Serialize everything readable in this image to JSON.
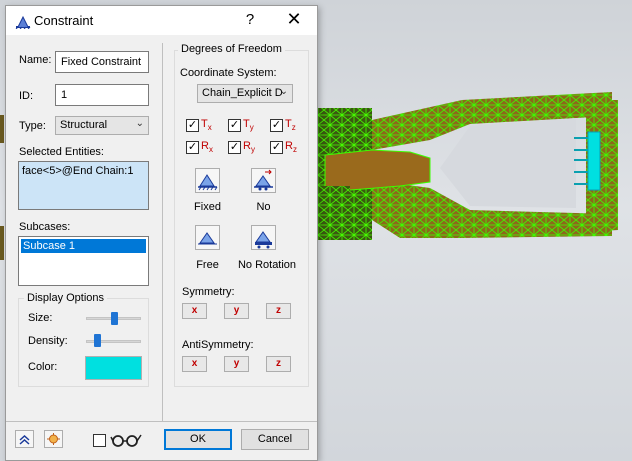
{
  "dialog": {
    "title": "Constraint",
    "help_glyph": "?",
    "close_glyph": "✕"
  },
  "fields": {
    "name_label": "Name:",
    "name_value": "Fixed Constraint",
    "id_label": "ID:",
    "id_value": "1",
    "type_label": "Type:",
    "type_value": "Structural",
    "selected_entities_label": "Selected Entities:",
    "selected_entities": [
      "face<5>@End Chain:1"
    ],
    "subcases_label": "Subcases:",
    "subcases": [
      "Subcase 1"
    ],
    "selected_subcase": "Subcase 1"
  },
  "display_options": {
    "title": "Display Options",
    "size_label": "Size:",
    "size_level": 0.5,
    "density_label": "Density:",
    "density_level": 0.2,
    "color_label": "Color:",
    "color": "#00e0e0"
  },
  "dof": {
    "title": "Degrees of Freedom",
    "coord_label": "Coordinate System:",
    "coord_value": "Chain_Explicit D",
    "checks": [
      {
        "base": "T",
        "sub": "x",
        "checked": true
      },
      {
        "base": "T",
        "sub": "y",
        "checked": true
      },
      {
        "base": "T",
        "sub": "z",
        "checked": true
      },
      {
        "base": "R",
        "sub": "x",
        "checked": true
      },
      {
        "base": "R",
        "sub": "y",
        "checked": true
      },
      {
        "base": "R",
        "sub": "z",
        "checked": true
      }
    ],
    "presets": [
      "Fixed",
      "No",
      "Free",
      "No Rotation"
    ],
    "symmetry_label": "Symmetry:",
    "antisymmetry_label": "AntiSymmetry:",
    "axes": [
      "x",
      "y",
      "z"
    ]
  },
  "footer": {
    "ok_label": "OK",
    "cancel_label": "Cancel",
    "show_checkbox_checked": false
  },
  "colors": {
    "accent": "#0078d7",
    "mesh_green": "#3cff00",
    "part_brown": "#9a6a1c",
    "constraint_cyan": "#00e0e0"
  }
}
